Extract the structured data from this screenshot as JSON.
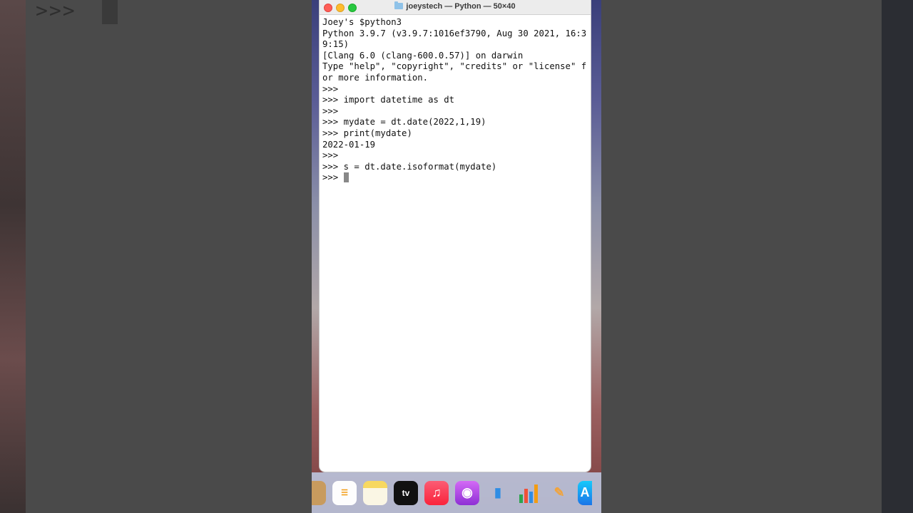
{
  "window": {
    "title": "joeystech — Python — 50×40"
  },
  "terminal": {
    "lines": [
      "Joey's $python3",
      "Python 3.9.7 (v3.9.7:1016ef3790, Aug 30 2021, 16:3",
      "9:15)",
      "[Clang 6.0 (clang-600.0.57)] on darwin",
      "Type \"help\", \"copyright\", \"credits\" or \"license\" f",
      "or more information.",
      ">>>",
      ">>> import datetime as dt",
      ">>>",
      ">>> mydate = dt.date(2022,1,19)",
      ">>> print(mydate)",
      "2022-01-19",
      ">>>",
      ">>> s = dt.date.isoformat(mydate)"
    ],
    "prompt": ">>> "
  },
  "background": {
    "prompt_text": ">>>"
  },
  "dock": {
    "items": [
      {
        "name": "contacts",
        "glyph": ""
      },
      {
        "name": "reminders",
        "glyph": "☰"
      },
      {
        "name": "notes",
        "glyph": ""
      },
      {
        "name": "tv",
        "glyph": "tv"
      },
      {
        "name": "music",
        "glyph": "♫"
      },
      {
        "name": "podcasts",
        "glyph": "◉"
      },
      {
        "name": "keynote",
        "glyph": "▮"
      },
      {
        "name": "numbers",
        "glyph": "▮"
      },
      {
        "name": "pages",
        "glyph": "✎"
      },
      {
        "name": "app-store",
        "glyph": "A"
      }
    ]
  }
}
